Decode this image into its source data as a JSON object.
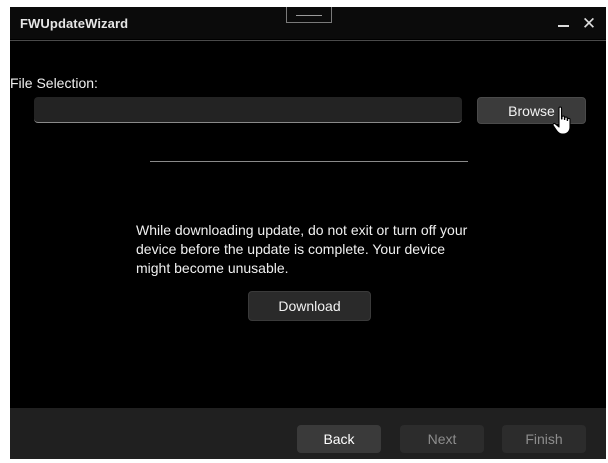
{
  "window": {
    "title": "FWUpdateWizard",
    "minimize_glyph": "",
    "close_glyph": "✕"
  },
  "file_selection": {
    "label": "File Selection:",
    "value": "",
    "placeholder": ""
  },
  "browse_label": "Browse",
  "progress": {
    "value_fraction": 0
  },
  "warning_text": "While downloading update, do not exit or turn off your device before the update is complete. Your device might become unusable.",
  "download_label": "Download",
  "footer": {
    "back_label": "Back",
    "next_label": "Next",
    "finish_label": "Finish"
  },
  "colors": {
    "window_bg": "#000000",
    "footer_bg": "#202020",
    "button_enabled": "#3a3a3a",
    "button_disabled": "#2c2c2c",
    "disabled_text": "#8d8d8d"
  },
  "icons": {
    "cursor": "hand-pointer-icon"
  }
}
